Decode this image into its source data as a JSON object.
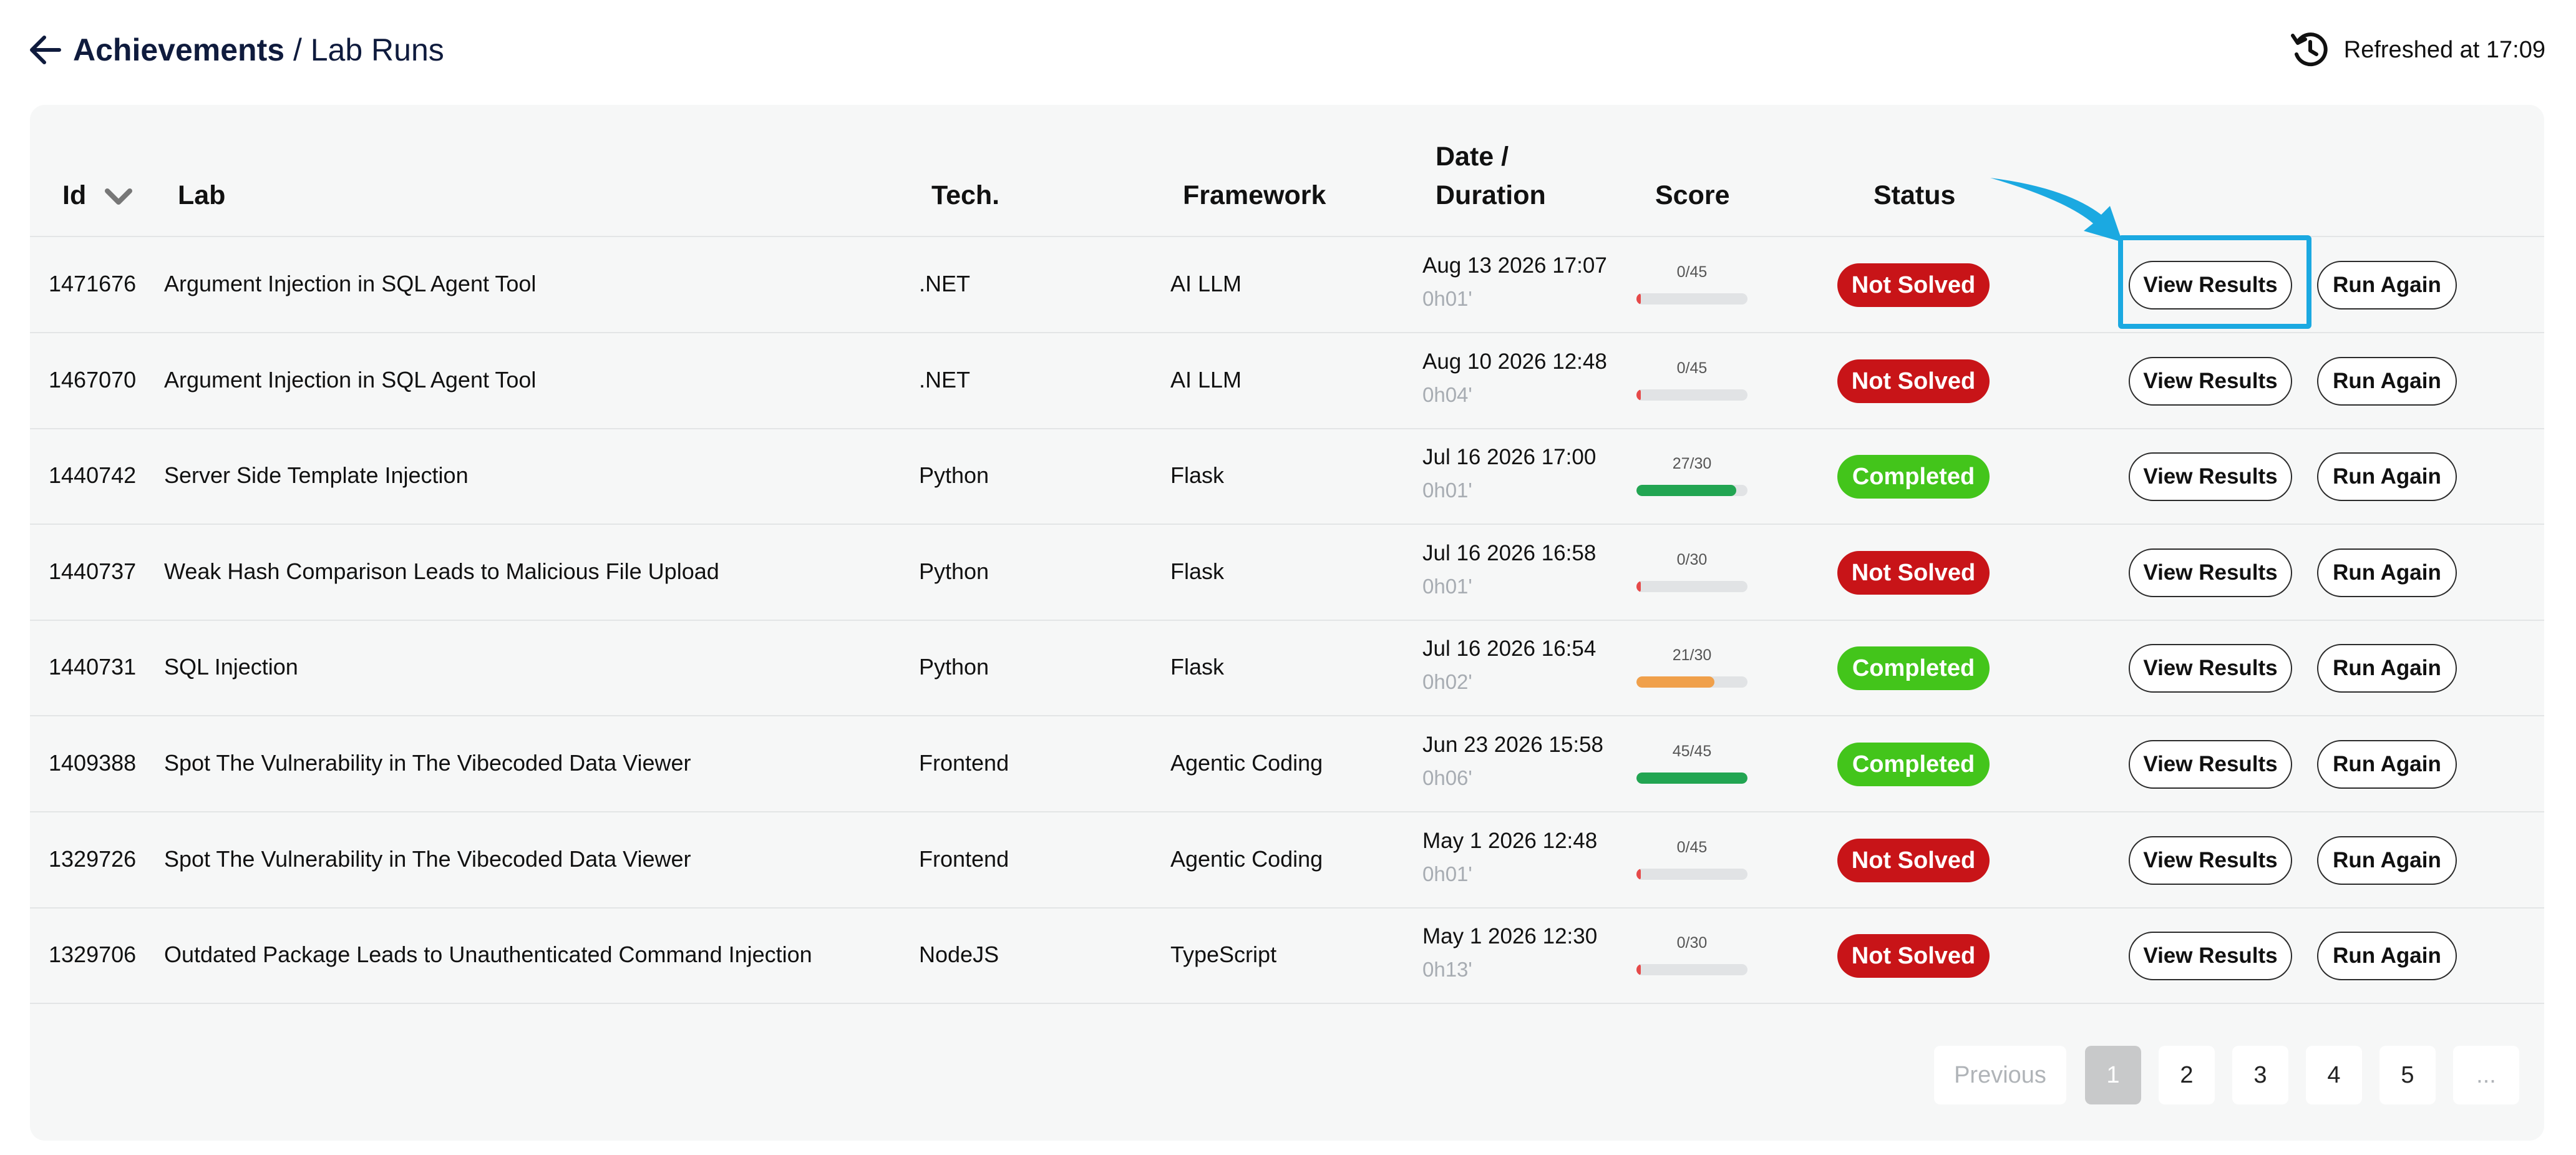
{
  "header": {
    "breadcrumb_main": "Achievements",
    "breadcrumb_sep": " / ",
    "breadcrumb_current": "Lab Runs",
    "refreshed": "Refreshed at 17:09"
  },
  "table": {
    "columns": {
      "id": "Id",
      "lab": "Lab",
      "tech": "Tech.",
      "framework": "Framework",
      "date_line1": "Date /",
      "date_line2": "Duration",
      "score": "Score",
      "status": "Status"
    },
    "view_label": "View Results",
    "run_label": "Run Again",
    "rows": [
      {
        "id": "1471676",
        "lab": "Argument Injection in SQL Agent Tool",
        "tech": ".NET",
        "framework": "AI LLM",
        "date": "Aug 13 2026 17:07",
        "duration": "0h01'",
        "score_text": "0/45",
        "score_fraction": 0.0,
        "status": "Not Solved"
      },
      {
        "id": "1467070",
        "lab": "Argument Injection in SQL Agent Tool",
        "tech": ".NET",
        "framework": "AI LLM",
        "date": "Aug 10 2026 12:48",
        "duration": "0h04'",
        "score_text": "0/45",
        "score_fraction": 0.0,
        "status": "Not Solved"
      },
      {
        "id": "1440742",
        "lab": "Server Side Template Injection",
        "tech": "Python",
        "framework": "Flask",
        "date": "Jul 16 2026 17:00",
        "duration": "0h01'",
        "score_text": "27/30",
        "score_fraction": 0.9,
        "status": "Completed"
      },
      {
        "id": "1440737",
        "lab": "Weak Hash Comparison Leads to Malicious File Upload",
        "tech": "Python",
        "framework": "Flask",
        "date": "Jul 16 2026 16:58",
        "duration": "0h01'",
        "score_text": "0/30",
        "score_fraction": 0.0,
        "status": "Not Solved"
      },
      {
        "id": "1440731",
        "lab": "SQL Injection",
        "tech": "Python",
        "framework": "Flask",
        "date": "Jul 16 2026 16:54",
        "duration": "0h02'",
        "score_text": "21/30",
        "score_fraction": 0.7,
        "status": "Completed"
      },
      {
        "id": "1409388",
        "lab": "Spot The Vulnerability in The Vibecoded Data Viewer",
        "tech": "Frontend",
        "framework": "Agentic Coding",
        "date": "Jun 23 2026 15:58",
        "duration": "0h06'",
        "score_text": "45/45",
        "score_fraction": 1.0,
        "status": "Completed"
      },
      {
        "id": "1329726",
        "lab": "Spot The Vulnerability in The Vibecoded Data Viewer",
        "tech": "Frontend",
        "framework": "Agentic Coding",
        "date": "May 1 2026 12:48",
        "duration": "0h01'",
        "score_text": "0/45",
        "score_fraction": 0.0,
        "status": "Not Solved"
      },
      {
        "id": "1329706",
        "lab": "Outdated Package Leads to Unauthenticated Command Injection",
        "tech": "NodeJS",
        "framework": "TypeScript",
        "date": "May 1 2026 12:30",
        "duration": "0h13'",
        "score_text": "0/30",
        "score_fraction": 0.0,
        "status": "Not Solved"
      }
    ]
  },
  "pagination": {
    "previous": "Previous",
    "pages": [
      "1",
      "2",
      "3",
      "4",
      "5"
    ],
    "more": "...",
    "current": "1"
  },
  "colors": {
    "not_solved": "#c81418",
    "completed": "#43c51b",
    "score_high": "#22a552",
    "score_mid": "#f0a04b",
    "score_zero": "#e64a4a",
    "highlight": "#1ba9e1"
  },
  "icons": {
    "back": "arrow-left-icon",
    "refresh": "history-refresh-icon",
    "sort": "chevron-down-icon",
    "annotation": "pointer-arrow-icon"
  }
}
